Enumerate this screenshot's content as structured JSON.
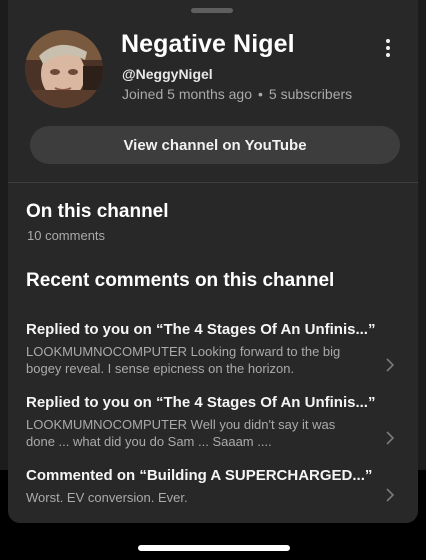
{
  "channel": {
    "name": "Negative Nigel",
    "handle": "@NeggyNigel",
    "joined": "Joined 5 months ago",
    "separator": "•",
    "subscribers": "5 subscribers",
    "view_button_label": "View channel on YouTube"
  },
  "on_channel": {
    "title": "On this channel",
    "count": "10 comments"
  },
  "recent": {
    "title": "Recent comments on this channel",
    "items": [
      {
        "title": "Replied to you on “The 4 Stages Of An Unfinis...”",
        "body": "LOOKMUMNOCOMPUTER Looking forward to the big bogey reveal. I sense epicness on the horizon."
      },
      {
        "title": "Replied to you on “The 4 Stages Of An Unfinis...”",
        "body": "LOOKMUMNOCOMPUTER Well you didn't say it was done ... what did you do Sam ... Saaam ...."
      },
      {
        "title": "Commented on “Building A SUPERCHARGED...”",
        "body": "Worst. EV conversion. Ever."
      }
    ]
  },
  "icons": {
    "more": "more-vert-icon",
    "chevron": "chevron-right-icon"
  },
  "colors": {
    "sheet_bg": "#282828",
    "button_bg": "#3d3d3d",
    "secondary_text": "#aaaaaa"
  }
}
